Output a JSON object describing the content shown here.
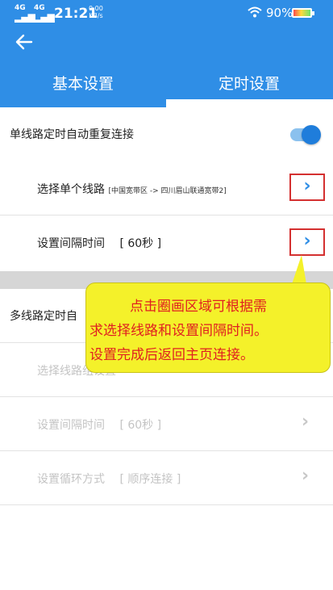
{
  "status_bar": {
    "signal1": "4G",
    "signal2": "4G",
    "time": "21:21",
    "speed_value": "0.00",
    "speed_unit": "KB/s",
    "battery_pct": "90%"
  },
  "tabs": {
    "basic": "基本设置",
    "timer": "定时设置"
  },
  "single": {
    "toggle_label": "单线路定时自动重复连接",
    "toggle_on": true,
    "select_label": "选择单个线路",
    "route_detail": "[中国宽带区 -> 四川眉山联通宽带2]",
    "interval_label": "设置间隔时间",
    "interval_value": "[ 60秒 ]"
  },
  "multi": {
    "toggle_label_visible": "多线路定时自",
    "select_label": "选择线路组设置",
    "interval_label": "设置间隔时间",
    "interval_value": "[ 60秒 ]",
    "loop_label": "设置循环方式",
    "loop_value": "[ 顺序连接 ]"
  },
  "tooltip": {
    "line1": "点击圈画区域可根据需",
    "line2": "求选择线路和设置间隔时间。",
    "line3": "设置完成后返回主页连接。"
  },
  "colors": {
    "primary": "#2f8ee6",
    "highlight_border": "#d43030",
    "tooltip_bg": "#f4f12a",
    "tooltip_text": "#e02020"
  },
  "icons": {
    "back": "arrow-left",
    "chevron": "chevron-right",
    "wifi": "wifi",
    "battery": "battery"
  }
}
